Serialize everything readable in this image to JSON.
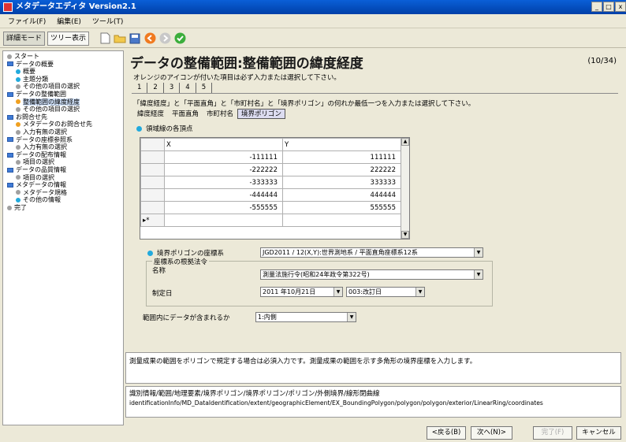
{
  "window": {
    "title": "メタデータエディタ Version2.1"
  },
  "menu": [
    "ファイル(F)",
    "編集(E)",
    "ツール(T)"
  ],
  "toolbar": {
    "detail_mode": "詳細モード",
    "tree_view": "ツリー表示"
  },
  "sidebar": {
    "items": [
      {
        "label": "スタート",
        "type": "dot",
        "color": "#a0a0a0",
        "indent": 1
      },
      {
        "label": "データの概要",
        "type": "folder",
        "indent": 1
      },
      {
        "label": "概要",
        "type": "dot",
        "color": "#22aadd",
        "indent": 2
      },
      {
        "label": "主題分類",
        "type": "dot",
        "color": "#22aadd",
        "indent": 2
      },
      {
        "label": "その他の項目の選択",
        "type": "dot",
        "color": "#a0a0a0",
        "indent": 2
      },
      {
        "label": "データの整備範囲",
        "type": "folder",
        "indent": 1
      },
      {
        "label": "整備範囲の緯度経度",
        "type": "dot",
        "color": "#f0a020",
        "indent": 2,
        "selected": true
      },
      {
        "label": "その他の項目の選択",
        "type": "dot",
        "color": "#a0a0a0",
        "indent": 2
      },
      {
        "label": "お問合せ先",
        "type": "folder",
        "indent": 1
      },
      {
        "label": "メタデータのお問合せ先",
        "type": "dot",
        "color": "#f0a020",
        "indent": 2
      },
      {
        "label": "入力有無の選択",
        "type": "dot",
        "color": "#a0a0a0",
        "indent": 2
      },
      {
        "label": "データの座標参照系",
        "type": "folder",
        "indent": 1
      },
      {
        "label": "入力有無の選択",
        "type": "dot",
        "color": "#a0a0a0",
        "indent": 2
      },
      {
        "label": "データの配布情報",
        "type": "folder",
        "indent": 1
      },
      {
        "label": "項目の選択",
        "type": "dot",
        "color": "#a0a0a0",
        "indent": 2
      },
      {
        "label": "データの品質情報",
        "type": "folder",
        "indent": 1
      },
      {
        "label": "項目の選択",
        "type": "dot",
        "color": "#a0a0a0",
        "indent": 2
      },
      {
        "label": "メタデータの情報",
        "type": "folder",
        "indent": 1
      },
      {
        "label": "メタデータ規格",
        "type": "dot",
        "color": "#a0a0a0",
        "indent": 2
      },
      {
        "label": "その他の情報",
        "type": "dot",
        "color": "#22aadd",
        "indent": 2
      },
      {
        "label": "完了",
        "type": "dot",
        "color": "#a0a0a0",
        "indent": 1
      }
    ]
  },
  "main": {
    "title": "データの整備範囲:整備範囲の緯度経度",
    "page_counter": "(10/34)",
    "notice": "オレンジのアイコンが付いた項目は必ず入力または選択して下さい。",
    "tabs": [
      "1",
      "2",
      "3",
      "4",
      "5"
    ],
    "instruction": "「緯度経度」と「平面直角」と「市町村名」と「境界ポリゴン」の何れか最低一つを入力または選択して下さい。",
    "subtabs": [
      "緯度経度",
      "平面直角",
      "市町村名",
      "境界ポリゴン"
    ],
    "section_vertices": "領域線の各頂点",
    "grid": {
      "headers": [
        "X",
        "Y"
      ],
      "rows": [
        [
          "-111111",
          "111111"
        ],
        [
          "-222222",
          "222222"
        ],
        [
          "-333333",
          "333333"
        ],
        [
          "-444444",
          "444444"
        ],
        [
          "-555555",
          "555555"
        ]
      ],
      "new_row_marker": "▸*"
    },
    "crs_label": "境界ポリゴンの座標系",
    "crs_value": "JGD2011 / 12(X,Y):世界測地系 / 平面直角座標系12系",
    "law_group_title": "座標系の根拠法令",
    "law_name_label": "名称",
    "law_name_value": "測量法施行令(昭和24年政令第322号)",
    "enact_label": "制定日",
    "enact_date": "2011 年10月21日",
    "enact_type": "003:改訂日",
    "inside_label": "範囲内にデータが含まれるか",
    "inside_value": "1:内側"
  },
  "description": "測量成果の範囲をポリゴンで規定する場合は必須入力です。測量成果の範囲を示す多角形の境界座標を入力します。",
  "xpath": {
    "jp": "識別情報/範囲/地理要素/境界ポリゴン/境界ポリゴン/ポリゴン/外側境界/線形閉曲線",
    "en": "identificationInfo/MD_DataIdentification/extent/geographicElement/EX_BoundingPolygon/polygon/polygon/exterior/LinearRing/coordinates"
  },
  "footer": {
    "back": "<戻る(B)",
    "next": "次へ(N)>",
    "finish": "完了(F)",
    "cancel": "キャンセル"
  }
}
